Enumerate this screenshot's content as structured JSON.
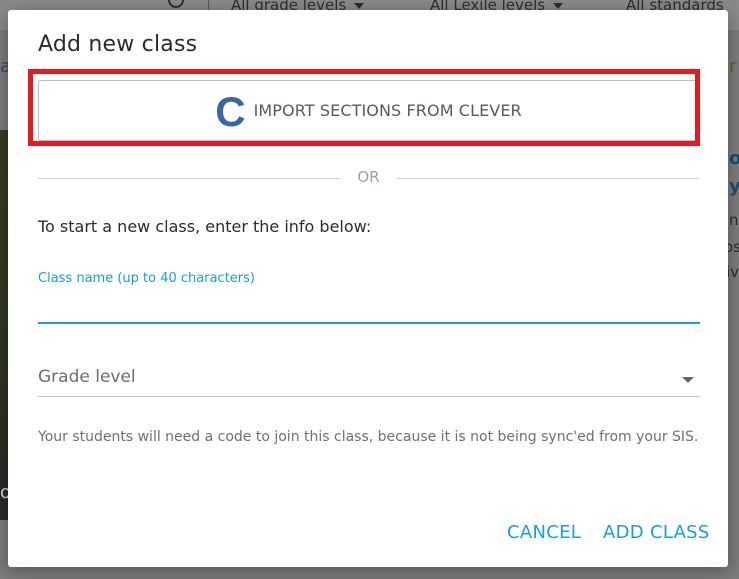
{
  "background": {
    "filters": [
      "All grade levels",
      "All Lexile levels",
      "All standards"
    ],
    "fragments": {
      "left_top": "ar",
      "right_top": "r",
      "right_teal_1": "o",
      "right_teal_2": "y",
      "right_text_1": "n",
      "right_text_2": "os",
      "right_text_3": "iv",
      "left_bottom": "o"
    },
    "colors": {
      "overlay": "#7d7d7d"
    }
  },
  "dialog": {
    "title": "Add new class",
    "clever_button": {
      "logo_letter": "C",
      "label": "IMPORT SECTIONS FROM CLEVER",
      "icon": "clever-logo-icon"
    },
    "or_text": "OR",
    "intro": "To start a new class, enter the info below:",
    "class_name": {
      "label": "Class name (up to 40 characters)",
      "value": ""
    },
    "grade_level": {
      "placeholder": "Grade level",
      "icon": "chevron-down-icon"
    },
    "hint": "Your students will need a code to join this class, because it is not being sync'ed from your SIS.",
    "actions": {
      "cancel": "CANCEL",
      "add_class": "ADD CLASS"
    },
    "colors": {
      "accent": "#1a9ed9",
      "highlight": "#e51b24",
      "clever_blue": "#3a66a7"
    }
  }
}
